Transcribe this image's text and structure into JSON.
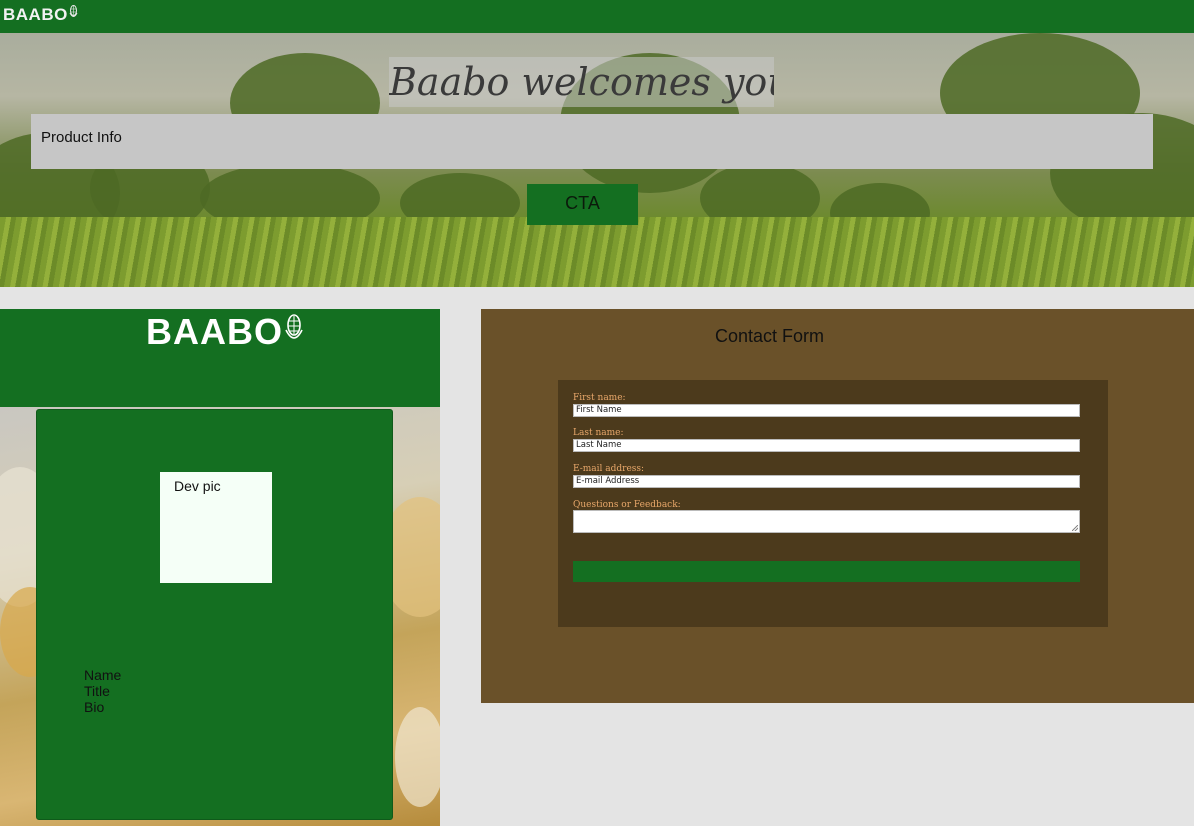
{
  "topbar": {
    "logo_text": "BAABO"
  },
  "hero": {
    "title": "Baabo welcomes you...",
    "product_info": "Product Info",
    "cta_label": "CTA"
  },
  "team": {
    "logo_text": "BAABO",
    "dev_pic_label": "Dev pic",
    "name": "Name",
    "title": "Title",
    "bio": "Bio"
  },
  "contact": {
    "heading": "Contact Form",
    "first_name_label": "First name:",
    "first_name_value": "First Name",
    "last_name_label": "Last name:",
    "last_name_value": "Last Name",
    "email_label": "E-mail address:",
    "email_value": "E-mail Address",
    "feedback_label": "Questions or Feedback:",
    "feedback_value": ""
  },
  "colors": {
    "brand_green": "#146f21",
    "panel_brown": "#6a5129",
    "form_dark": "#4c3a1c",
    "label_orange": "#e8a76a"
  },
  "icons": {
    "logo_icon": "corn-icon"
  }
}
